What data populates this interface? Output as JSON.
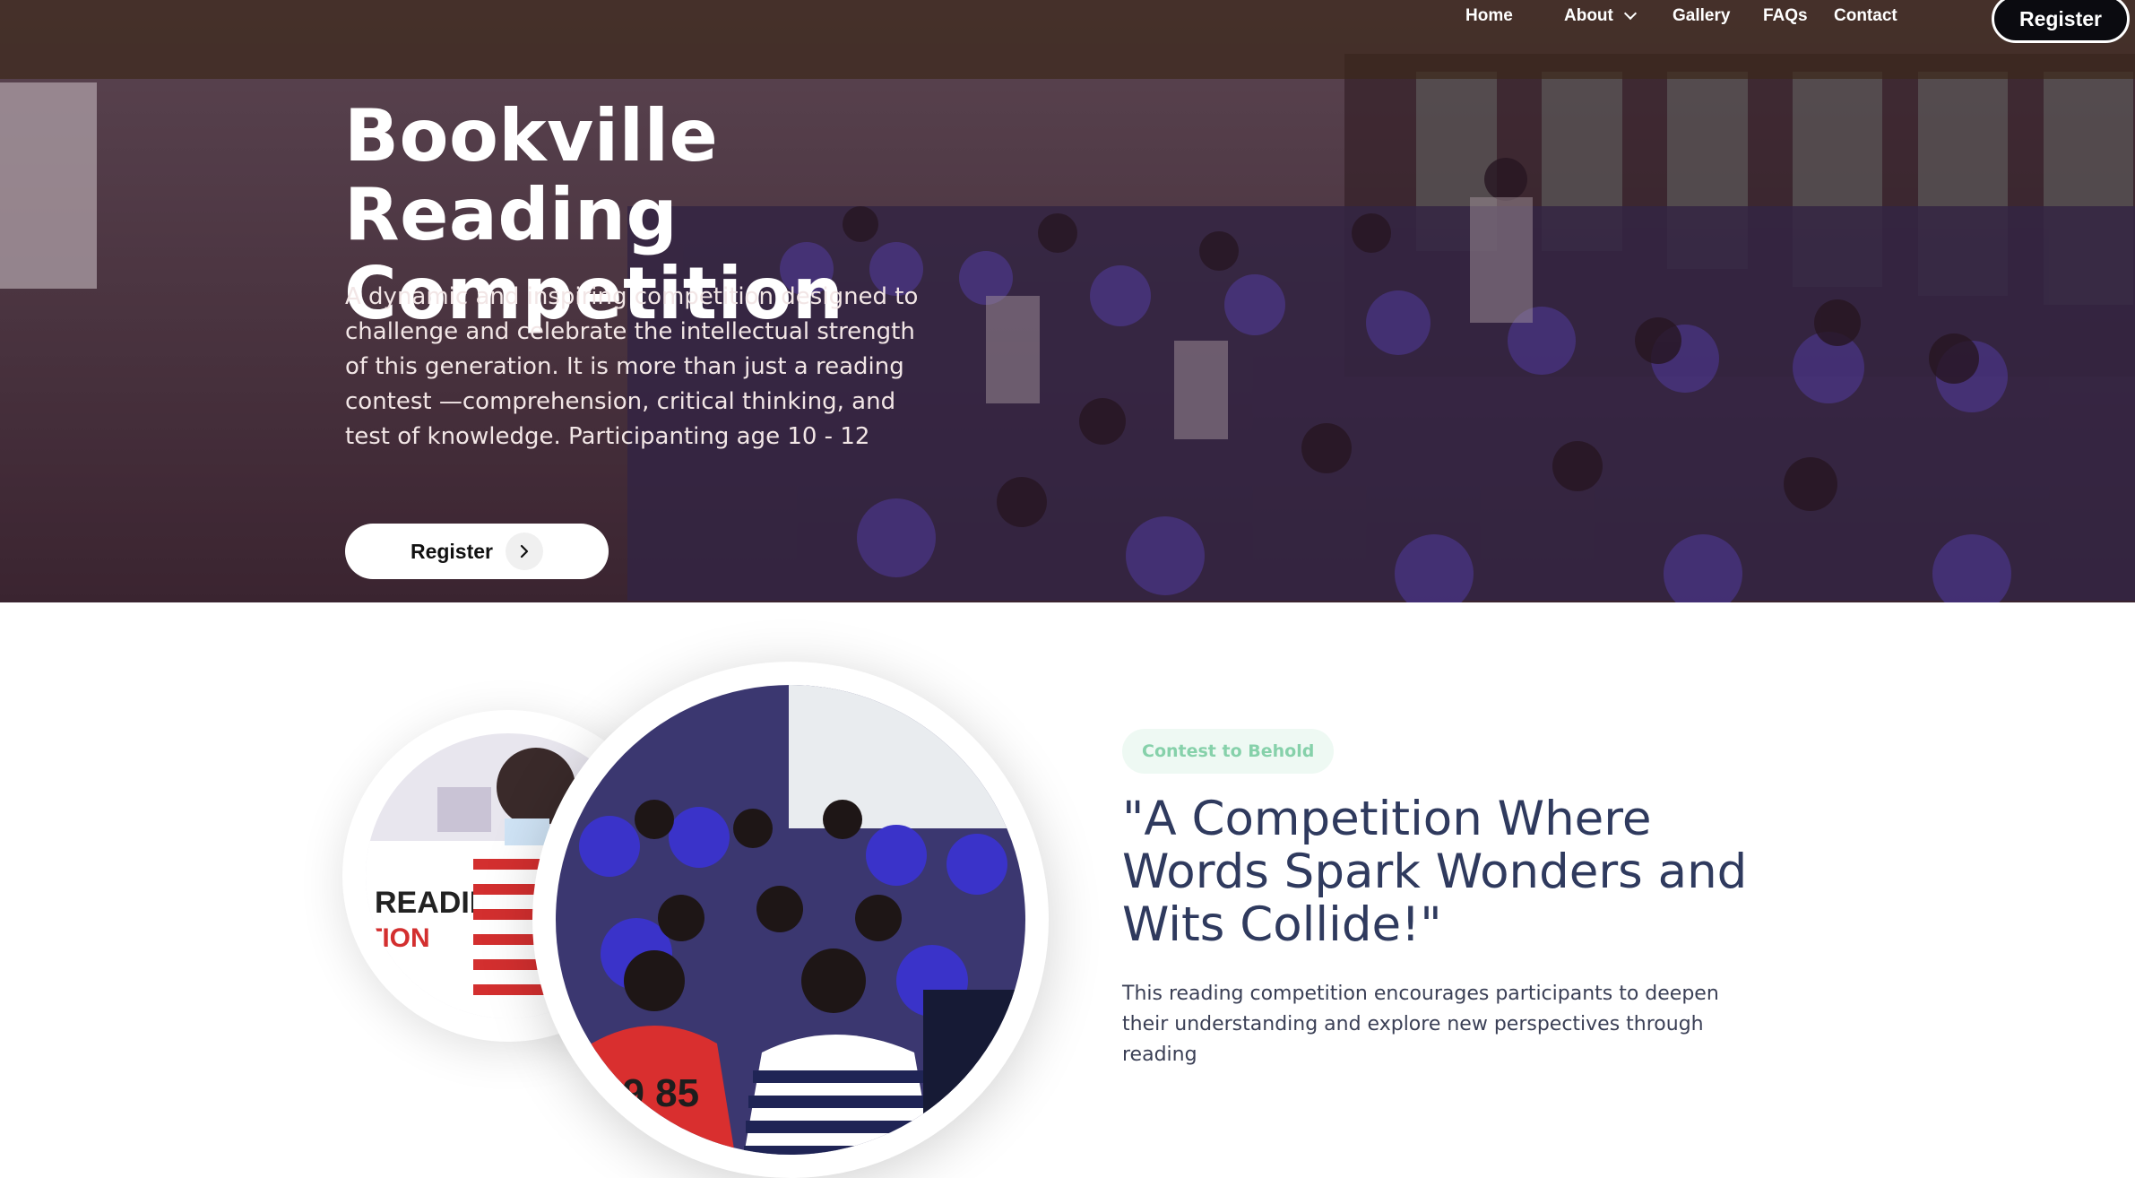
{
  "nav": {
    "home": "Home",
    "about": "About",
    "gallery": "Gallery",
    "faqs": "FAQs",
    "contact": "Contact",
    "register": "Register"
  },
  "hero": {
    "title": "Bookville Reading Competition",
    "description": "A dynamic and inspiring competition designed to challenge and celebrate the intellectual strength of this generation. It is more than just a reading contest —comprehension, critical thinking, and test of knowledge. Participanting age 10 - 12",
    "register": "Register",
    "register_icon": "chevron-right-icon"
  },
  "about_section": {
    "badge": "Contest to Behold",
    "heading": "\"A Competition Where Words Spark Wonders and Wits Collide!\"",
    "text": "This reading competition encourages participants to deepen their understanding and explore new perspectives through reading"
  },
  "colors": {
    "badge_text": "#86d1aa",
    "badge_bg": "#eef9f3",
    "heading": "#2f3a5e"
  }
}
